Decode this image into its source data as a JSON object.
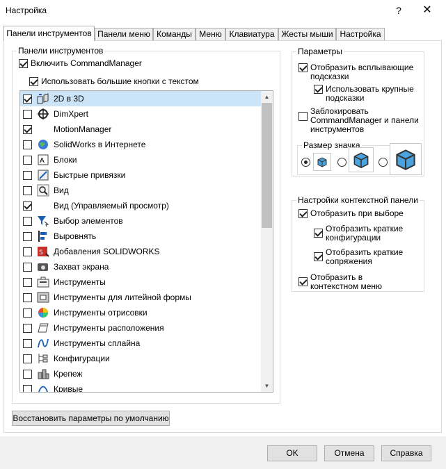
{
  "window": {
    "title": "Настройка",
    "help_glyph": "?",
    "close_glyph": "✕"
  },
  "tabs": [
    {
      "label": "Панели инструментов",
      "active": true
    },
    {
      "label": "Панели меню",
      "active": false
    },
    {
      "label": "Команды",
      "active": false
    },
    {
      "label": "Меню",
      "active": false
    },
    {
      "label": "Клавиатура",
      "active": false
    },
    {
      "label": "Жесты мыши",
      "active": false
    },
    {
      "label": "Настройка",
      "active": false
    }
  ],
  "toolbars_group": {
    "title": "Панели инструментов",
    "enable_commandmanager": {
      "label": "Включить CommandManager",
      "checked": true
    },
    "large_buttons": {
      "label": "Использовать большие кнопки с текстом",
      "checked": true
    },
    "items": [
      {
        "label": "2D в 3D",
        "checked": true,
        "selected": true,
        "icon": "2d-to-3d-icon"
      },
      {
        "label": "DimXpert",
        "checked": false,
        "icon": "dimxpert-icon"
      },
      {
        "label": "MotionManager",
        "checked": true,
        "icon": "none"
      },
      {
        "label": "SolidWorks в Интернете",
        "checked": false,
        "icon": "web-globe-icon"
      },
      {
        "label": "Блоки",
        "checked": false,
        "icon": "blocks-icon"
      },
      {
        "label": "Быстрые привязки",
        "checked": false,
        "icon": "quick-snaps-icon"
      },
      {
        "label": "Вид",
        "checked": false,
        "icon": "view-icon"
      },
      {
        "label": "Вид (Управляемый просмотр)",
        "checked": true,
        "icon": "none"
      },
      {
        "label": "Выбор элементов",
        "checked": false,
        "icon": "selection-filter-icon"
      },
      {
        "label": "Выровнять",
        "checked": false,
        "icon": "align-icon"
      },
      {
        "label": "Добавления SOLIDWORKS",
        "checked": false,
        "icon": "addins-icon"
      },
      {
        "label": "Захват экрана",
        "checked": false,
        "icon": "screen-capture-icon"
      },
      {
        "label": "Инструменты",
        "checked": false,
        "icon": "tools-icon"
      },
      {
        "label": "Инструменты для литейной формы",
        "checked": false,
        "icon": "mold-tools-icon"
      },
      {
        "label": "Инструменты отрисовки",
        "checked": false,
        "icon": "render-tools-icon"
      },
      {
        "label": "Инструменты расположения",
        "checked": false,
        "icon": "layout-tools-icon"
      },
      {
        "label": "Инструменты сплайна",
        "checked": false,
        "icon": "spline-tools-icon"
      },
      {
        "label": "Конфигурации",
        "checked": false,
        "icon": "configurations-icon"
      },
      {
        "label": "Крепеж",
        "checked": false,
        "icon": "fastening-icon"
      },
      {
        "label": "Кривые",
        "checked": false,
        "icon": "curves-icon"
      }
    ],
    "restore_button": "Восстановить параметры по умолчанию"
  },
  "parameters_group": {
    "title": "Параметры",
    "show_tooltips": {
      "label_line1": "Отобразить всплывающие",
      "label_line2": "подсказки",
      "checked": true
    },
    "large_tooltips": {
      "label_line1": "Использовать крупные",
      "label_line2": "подсказки",
      "checked": true
    },
    "lock_cm": {
      "label_line1": "Заблокировать",
      "label_line2": "CommandManager и панели",
      "label_line3": "инструментов",
      "checked": false
    },
    "icon_size": {
      "title": "Размер значка",
      "options": [
        "small",
        "medium",
        "large"
      ],
      "selected": "small"
    }
  },
  "context_group": {
    "title": "Настройки контекстной панели",
    "show_on_select": {
      "label": "Отобразить при выборе",
      "checked": true
    },
    "show_short_configs": {
      "label_line1": "Отобразить краткие",
      "label_line2": "конфигурации",
      "checked": true
    },
    "show_short_mates": {
      "label_line1": "Отобразить краткие",
      "label_line2": "сопряжения",
      "checked": true
    },
    "show_in_context_menu": {
      "label_line1": "Отобразить в",
      "label_line2": "контекстном меню",
      "checked": true
    }
  },
  "footer": {
    "ok": "OK",
    "cancel": "Отмена",
    "help": "Справка"
  }
}
